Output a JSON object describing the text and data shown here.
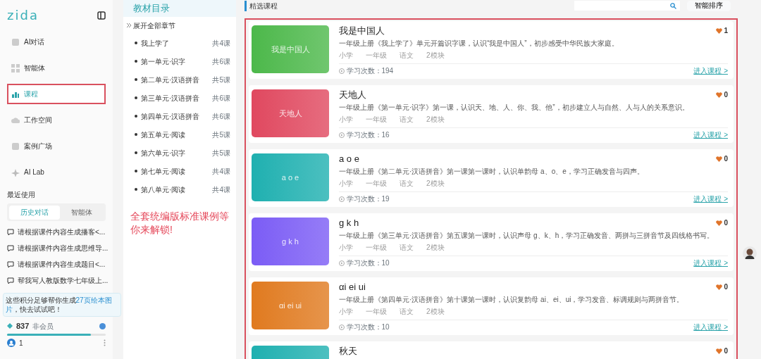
{
  "sidebar": {
    "logo": "zida",
    "nav": [
      {
        "label": "AI对话",
        "selected": false,
        "annotated": false
      },
      {
        "label": "智能体",
        "selected": false,
        "annotated": false
      },
      {
        "label": "课程",
        "selected": true,
        "annotated": true
      },
      {
        "label": "工作空间",
        "selected": false,
        "annotated": false
      },
      {
        "label": "案例广场",
        "selected": false,
        "annotated": false
      },
      {
        "label": "AI Lab",
        "selected": false,
        "annotated": false
      }
    ],
    "recent_title": "最近使用",
    "recent_tabs": [
      {
        "label": "历史对话",
        "selected": true
      },
      {
        "label": "智能体",
        "selected": false
      }
    ],
    "history": [
      "请根据课件内容生成播客<...",
      "请根据课件内容生成思维导...",
      "请根据课件内容生成题目<...",
      "帮我写人教版数学七年级上..."
    ],
    "banner": [
      {
        "text": "这些积分足够帮你生成",
        "highlight": false
      },
      {
        "text": "27页绘本图片",
        "highlight": true
      },
      {
        "text": "，快去试试吧！",
        "highlight": false
      }
    ],
    "points": {
      "value": "837",
      "membership": "非会员",
      "level": 0.85
    },
    "user": {
      "name": "1"
    }
  },
  "catalog": {
    "title": "教材目录",
    "expand": "展开全部章节",
    "chapters": [
      {
        "name": "我上学了",
        "count": "共4课"
      },
      {
        "name": "第一单元·识字",
        "count": "共6课"
      },
      {
        "name": "第二单元·汉语拼音",
        "count": "共5课"
      },
      {
        "name": "第三单元·汉语拼音",
        "count": "共6课"
      },
      {
        "name": "第四单元·汉语拼音",
        "count": "共6课"
      },
      {
        "name": "第五单元·阅读",
        "count": "共5课"
      },
      {
        "name": "第六单元·识字",
        "count": "共5课"
      },
      {
        "name": "第七单元·阅读",
        "count": "共4课"
      },
      {
        "name": "第八单元·阅读",
        "count": "共4课"
      }
    ],
    "promo": "全套统编版标准课例等你来解锁!"
  },
  "courses": {
    "title": "精选课程",
    "sort_button": "智能排序",
    "annotated": true,
    "items": [
      {
        "thumb_text": "我是中国人",
        "color": "#4cb84a",
        "title": "我是中国人",
        "description": "一年级上册《我上学了》单元开篇识字课，认识“我是中国人”，初步感受中华民族大家庭。",
        "tags": [
          "小学",
          "一年级",
          "语文",
          "2模块"
        ],
        "study_count": "学习次数：194",
        "likes": "1",
        "link": "进入课程 >"
      },
      {
        "thumb_text": "天地人",
        "color": "#e0485f",
        "title": "天地人",
        "description": "一年级上册《第一单元·识字》第一课，认识天、地、人、你、我、他”，初步建立人与自然、人与人的关系意识。",
        "tags": [
          "小学",
          "一年级",
          "语文",
          "2模块"
        ],
        "study_count": "学习次数：16",
        "likes": "0",
        "link": "进入课程 >"
      },
      {
        "thumb_text": "a o e",
        "color": "#1fb0b0",
        "title": "a o e",
        "description": "一年级上册《第二单元·汉语拼音》第一课第一课时，认识单韵母 a、o、e，学习正确发音与四声。",
        "tags": [
          "小学",
          "一年级",
          "语文",
          "2模块"
        ],
        "study_count": "学习次数：19",
        "likes": "0",
        "link": "进入课程 >"
      },
      {
        "thumb_text": "g k h",
        "color": "#7b5cf5",
        "title": "g k h",
        "description": "一年级上册《第三单元·汉语拼音》第五课第一课时，认识声母 g、k、h，学习正确发音、两拼与三拼音节及四线格书写。",
        "tags": [
          "小学",
          "一年级",
          "语文",
          "2模块"
        ],
        "study_count": "学习次数：10",
        "likes": "0",
        "link": "进入课程 >"
      },
      {
        "thumb_text": "αi ei ui",
        "color": "#e07a1f",
        "title": "αi ei ui",
        "description": "一年级上册《第四单元·汉语拼音》第十课第一课时，认识复韵母 ai、ei、ui，学习发音、标调规则与两拼音节。",
        "tags": [
          "小学",
          "一年级",
          "语文",
          "2模块"
        ],
        "study_count": "学习次数：10",
        "likes": "0",
        "link": "进入课程 >"
      },
      {
        "color": "#1fb0b0",
        "title": "秋天",
        "likes": "0"
      }
    ]
  }
}
